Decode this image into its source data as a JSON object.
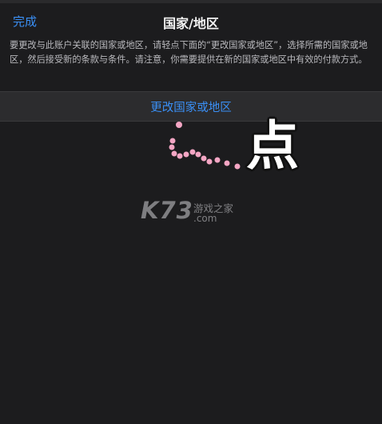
{
  "nav": {
    "done_label": "完成",
    "title": "国家/地区"
  },
  "description": "要更改与此账户关联的国家或地区，请轻点下面的“更改国家或地区”，选择所需的国家或地区，然后接受新的条款与条件。请注意，你需要提供在新的国家或地区中有效的付款方式。",
  "action": {
    "change_region_label": "更改国家或地区"
  },
  "annotation": {
    "tap_label": "点",
    "dot_color": "#f4a6c4"
  },
  "watermark": {
    "brand": "K73",
    "site_cn": "游戏之家",
    "site_suffix": ".com"
  },
  "colors": {
    "accent": "#3a8ff5",
    "background": "#1c1c1e"
  }
}
